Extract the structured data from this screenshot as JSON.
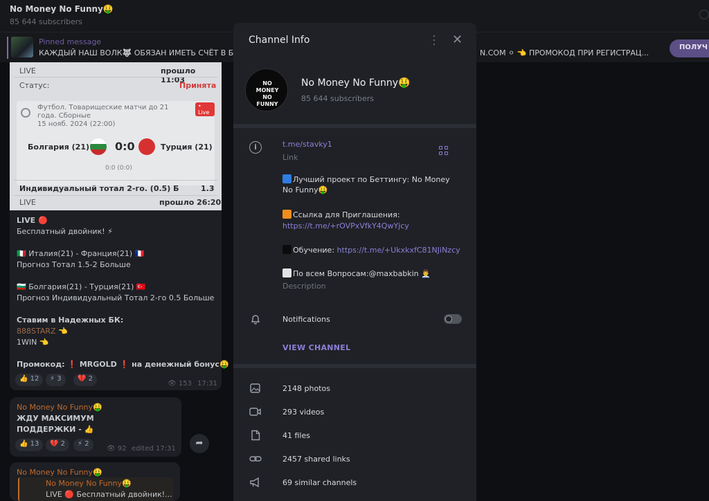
{
  "chat": {
    "title": "No Money No Funny🤑",
    "subscribers": "85 644 subscribers"
  },
  "pinned": {
    "label": "Pinned message",
    "text": "КАЖДЫЙ НАШ ВОЛК🐺 ОБЯЗАН ИМЕТЬ СЧЁТ В Б",
    "tail": "N.COM ⚪ 👈 ПРОМОКОД ПРИ РЕГИСТРАЦ...",
    "button": "ПОЛУЧ"
  },
  "card": {
    "top_left": "LIVE",
    "top_right": "прошло 11:03",
    "status_label": "Статус:",
    "status_value": "Принята",
    "live_badge": "• Live",
    "league": "Футбол. Товарищеские матчи до 21",
    "league2": "года. Сборные",
    "date": "15 нояб. 2024 (22:00)",
    "team1": "Болгария (21)",
    "score": "0:0",
    "team2": "Турция (21)",
    "half": "0:0 (0:0)",
    "bet": "Индивидуальный тотал 2-го. (0.5) Б",
    "odds": "1.3",
    "bottom_left": "LIVE",
    "bottom_right": "прошло 26:20"
  },
  "message1": {
    "line1": "LIVE 🔴",
    "line2": "Бесплатный двойник! ⚡",
    "line3": "🇮🇹 Италия(21) - Франция(21) 🇫🇷",
    "line4": "Прогноз Тотал 1.5-2 Больше",
    "line5": "🇧🇬 Болгария(21) - Турция(21) 🇹🇷",
    "line6": "Прогноз Индивидуальный Тотал 2-го 0.5 Больше",
    "line7": "Ставим в Надежных БК:",
    "line8": "888STARZ 👈",
    "line9": "1WIN 👈",
    "line10": "Промокод: ❗ MRGOLD ❗ на денежный бонус🤑",
    "reactions": [
      "👍 12",
      "⚡ 3",
      "💔 2"
    ],
    "views": "👁 153",
    "time": "17:31"
  },
  "message2": {
    "author": "No Money No Funny🤑",
    "line1": "ЖДУ МАКСИМУМ",
    "line2": "ПОДДЕРЖКИ - 👍",
    "reactions": [
      "👍 13",
      "💔 2",
      "⚡ 2"
    ],
    "views": "👁 92",
    "time": "edited 17:31"
  },
  "message3": {
    "author": "No Money No Funny🤑",
    "quote_author": "No Money No Funny🤑",
    "quote_text": "LIVE 🔴 Бесплатный двойник!..."
  },
  "panel": {
    "title": "Channel Info",
    "channel_name": "No Money No Funny🤑",
    "subscribers": "85 644 subscribers",
    "avatar_text": "NO MONEY NO FUNNY",
    "link": "t.me/stavky1",
    "link_label": "Link",
    "desc1a": "Лучший проект по Беттингу: No Money",
    "desc1b": "No Funny🤑",
    "desc2": "Ссылка для Приглашения:",
    "desc2_link": "https://t.me/+rOVPxVfkY4QwYjcy",
    "desc3": "Обучение: ",
    "desc3_link": "https://t.me/+UkxkxfC81NJiNzcy",
    "desc4": "По всем Вопросам:@maxbabkin 👨‍💼",
    "desc_label": "Description",
    "notifications": "Notifications",
    "view_channel": "VIEW CHANNEL",
    "media": [
      {
        "icon": "photo-icon",
        "label": "2148 photos"
      },
      {
        "icon": "video-icon",
        "label": "293 videos"
      },
      {
        "icon": "file-icon",
        "label": "41 files"
      },
      {
        "icon": "link-icon",
        "label": "2457 shared links"
      },
      {
        "icon": "megaphone-icon",
        "label": "69 similar channels"
      }
    ]
  },
  "colors": {
    "accent": "#8b7fd6",
    "panel_bg": "#1f2126",
    "chat_bg": "#0e0f12",
    "live_red": "#e03838"
  }
}
